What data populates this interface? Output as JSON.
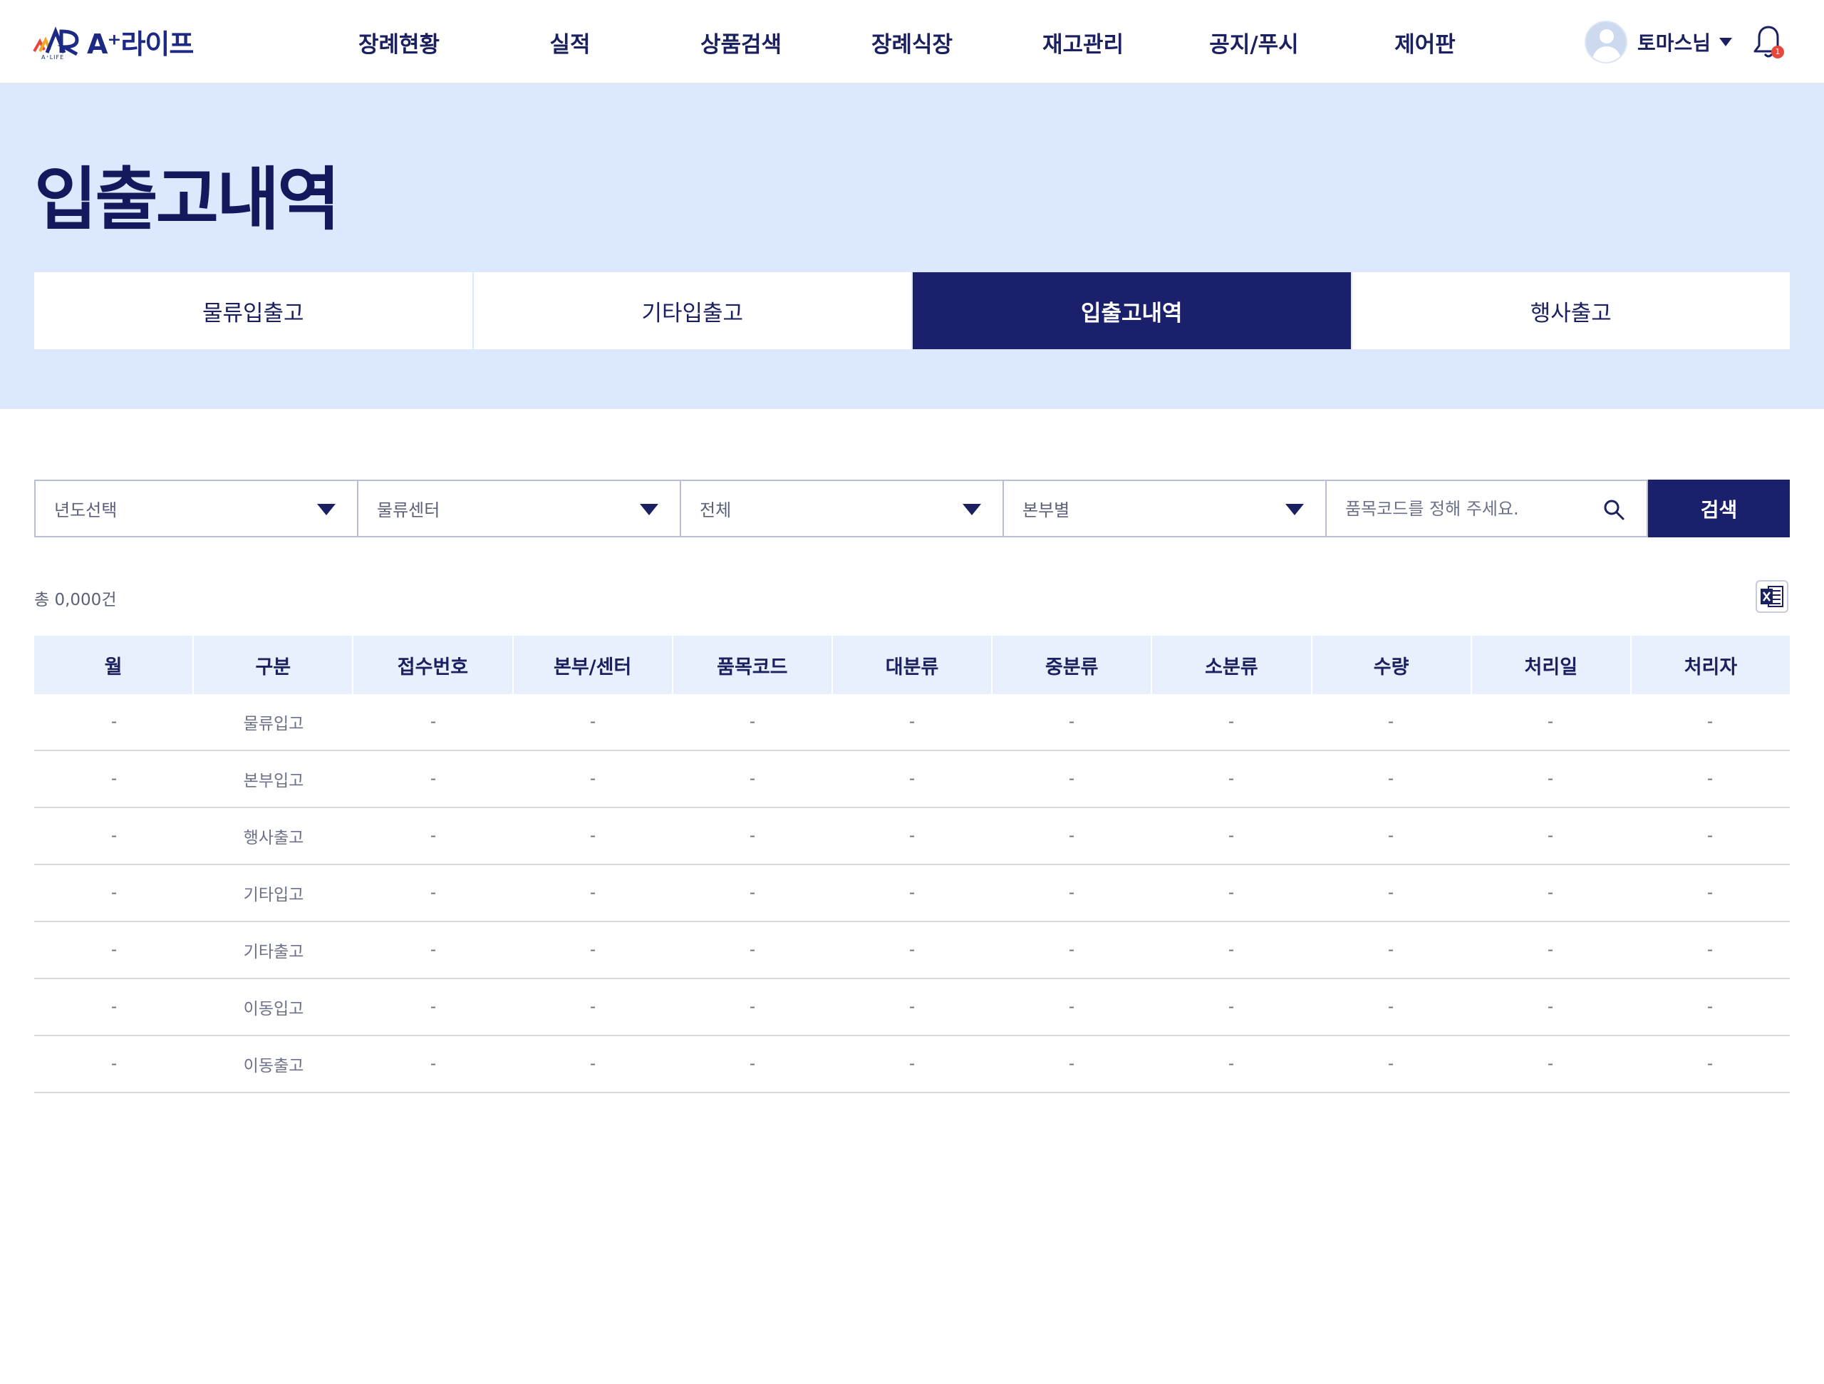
{
  "header": {
    "logo_text": "A⁺라이프",
    "logo_sub": "A⁺LIFE",
    "nav": [
      "장례현황",
      "실적",
      "상품검색",
      "장례식장",
      "재고관리",
      "공지/푸시",
      "제어판"
    ],
    "user_name": "토마스님",
    "notification_count": "1"
  },
  "hero": {
    "title": "입출고내역",
    "tabs": [
      {
        "label": "물류입출고",
        "active": false
      },
      {
        "label": "기타입출고",
        "active": false
      },
      {
        "label": "입출고내역",
        "active": true
      },
      {
        "label": "행사출고",
        "active": false
      }
    ]
  },
  "filters": {
    "year": "년도선택",
    "center": "물류센터",
    "type": "전체",
    "division": "본부별",
    "search_placeholder": "품목코드를 정해 주세요.",
    "search_button": "검색"
  },
  "summary": {
    "total": "총 0,000건"
  },
  "colors": {
    "primary": "#1a206b",
    "hero_bg": "#dbe8fd",
    "table_header_bg": "#e8f0fd",
    "excel_green": "#1d6f42"
  },
  "table": {
    "columns": [
      "월",
      "구분",
      "접수번호",
      "본부/센터",
      "품목코드",
      "대분류",
      "중분류",
      "소분류",
      "수량",
      "처리일",
      "처리자"
    ],
    "rows": [
      [
        "-",
        "물류입고",
        "-",
        "-",
        "-",
        "-",
        "-",
        "-",
        "-",
        "-",
        "-"
      ],
      [
        "-",
        "본부입고",
        "-",
        "-",
        "-",
        "-",
        "-",
        "-",
        "-",
        "-",
        "-"
      ],
      [
        "-",
        "행사출고",
        "-",
        "-",
        "-",
        "-",
        "-",
        "-",
        "-",
        "-",
        "-"
      ],
      [
        "-",
        "기타입고",
        "-",
        "-",
        "-",
        "-",
        "-",
        "-",
        "-",
        "-",
        "-"
      ],
      [
        "-",
        "기타출고",
        "-",
        "-",
        "-",
        "-",
        "-",
        "-",
        "-",
        "-",
        "-"
      ],
      [
        "-",
        "이동입고",
        "-",
        "-",
        "-",
        "-",
        "-",
        "-",
        "-",
        "-",
        "-"
      ],
      [
        "-",
        "이동출고",
        "-",
        "-",
        "-",
        "-",
        "-",
        "-",
        "-",
        "-",
        "-"
      ]
    ]
  }
}
